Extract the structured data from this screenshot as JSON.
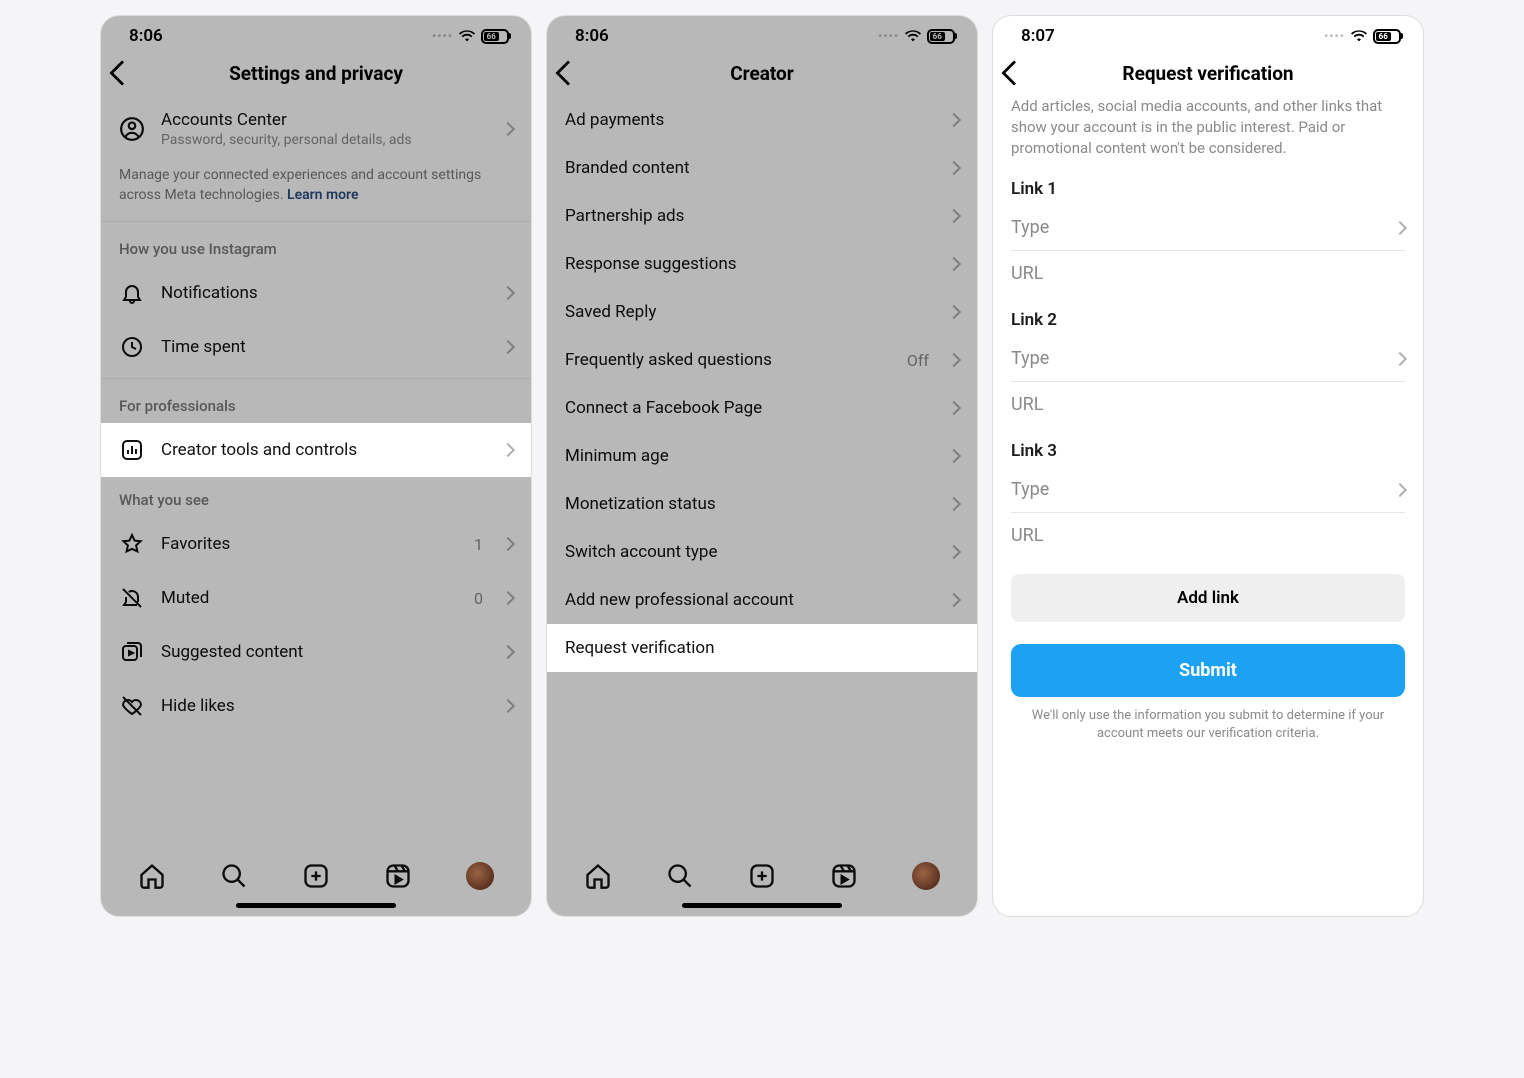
{
  "statusbar": {
    "time1": "8:06",
    "time2": "8:06",
    "time3": "8:07",
    "battery": "66"
  },
  "screen1": {
    "title": "Settings and privacy",
    "accounts_center": {
      "title": "Accounts Center",
      "subtitle": "Password, security, personal details, ads"
    },
    "meta_desc": "Manage your connected experiences and account settings across Meta technologies. ",
    "learn_more": "Learn more",
    "sec_how": "How you use Instagram",
    "notifications": "Notifications",
    "time_spent": "Time spent",
    "sec_pro": "For professionals",
    "creator_tools": "Creator tools and controls",
    "sec_see": "What you see",
    "favorites": "Favorites",
    "favorites_val": "1",
    "muted": "Muted",
    "muted_val": "0",
    "suggested": "Suggested content",
    "hide_likes": "Hide likes"
  },
  "screen2": {
    "title": "Creator",
    "items": [
      {
        "label": "Ad payments"
      },
      {
        "label": "Branded content"
      },
      {
        "label": "Partnership ads"
      },
      {
        "label": "Response suggestions"
      },
      {
        "label": "Saved Reply"
      },
      {
        "label": "Frequently asked questions",
        "val": "Off"
      },
      {
        "label": "Connect a Facebook Page"
      },
      {
        "label": "Minimum age"
      },
      {
        "label": "Monetization status"
      },
      {
        "label": "Switch account type"
      },
      {
        "label": "Add new professional account"
      }
    ],
    "request_verification": "Request verification"
  },
  "screen3": {
    "title": "Request verification",
    "desc": "Add articles, social media accounts, and other links that show your account is in the public interest. Paid or promotional content won't be considered.",
    "link1": "Link 1",
    "link2": "Link 2",
    "link3": "Link 3",
    "type_ph": "Type",
    "url_ph": "URL",
    "add_link": "Add link",
    "submit": "Submit",
    "footer": "We'll only use the information you submit to determine if your account meets our verification criteria."
  }
}
